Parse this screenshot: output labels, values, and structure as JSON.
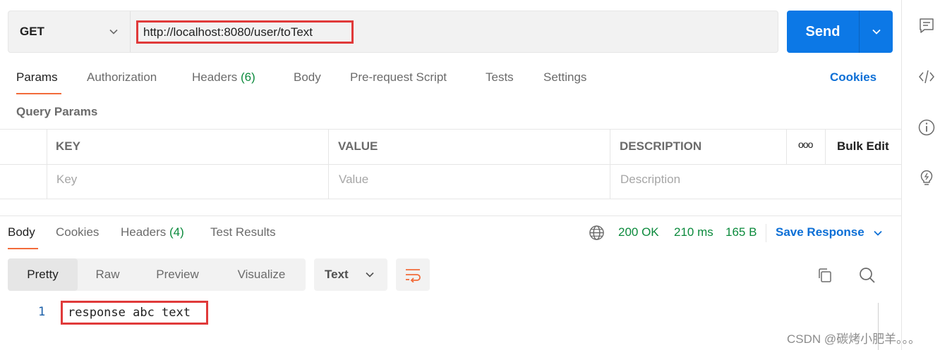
{
  "request": {
    "method": "GET",
    "url": "http://localhost:8080/user/toText",
    "send_label": "Send"
  },
  "request_tabs": [
    {
      "label": "Params"
    },
    {
      "label": "Authorization"
    },
    {
      "label": "Headers",
      "count": "(6)"
    },
    {
      "label": "Body"
    },
    {
      "label": "Pre-request Script"
    },
    {
      "label": "Tests"
    },
    {
      "label": "Settings"
    }
  ],
  "cookies_label": "Cookies",
  "query_params": {
    "title": "Query Params",
    "columns": {
      "key": "KEY",
      "value": "VALUE",
      "description": "DESCRIPTION"
    },
    "placeholders": {
      "key": "Key",
      "value": "Value",
      "description": "Description"
    },
    "more_label": "ooo",
    "bulk_edit_label": "Bulk Edit"
  },
  "response_tabs": [
    {
      "label": "Body"
    },
    {
      "label": "Cookies"
    },
    {
      "label": "Headers",
      "count": "(4)"
    },
    {
      "label": "Test Results"
    }
  ],
  "response_status": {
    "status": "200 OK",
    "time": "210 ms",
    "size": "165 B",
    "save_label": "Save Response"
  },
  "view_modes": [
    {
      "label": "Pretty"
    },
    {
      "label": "Raw"
    },
    {
      "label": "Preview"
    },
    {
      "label": "Visualize"
    }
  ],
  "format_select": "Text",
  "response_body": {
    "line_number": "1",
    "text": "response abc text"
  },
  "watermark": "CSDN @碳烤小肥羊。。。",
  "colors": {
    "accent_orange": "#f26b3a",
    "send_blue": "#0c78e6",
    "link_blue": "#0c6fd6",
    "success_green": "#0b8a3c",
    "highlight_red": "#e03a3a"
  }
}
